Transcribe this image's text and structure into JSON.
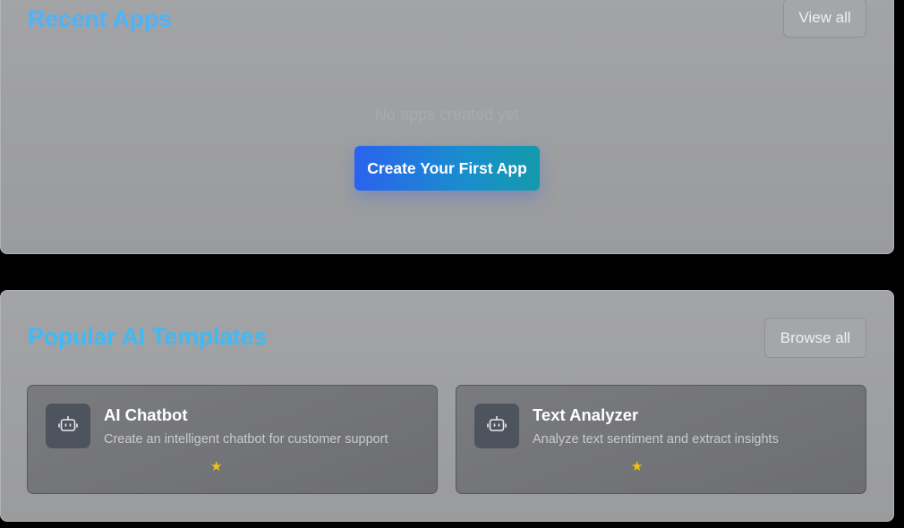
{
  "recent_apps": {
    "title": "Recent Apps",
    "view_all_label": "View all",
    "empty_text": "No apps created yet",
    "create_label": "Create Your First App"
  },
  "templates": {
    "title": "Popular AI Templates",
    "browse_all_label": "Browse all",
    "cards": [
      {
        "icon": "bot-icon",
        "title": "AI Chatbot",
        "description": "Create an intelligent chatbot for customer support",
        "rating_icon": "star-icon"
      },
      {
        "icon": "bot-icon",
        "title": "Text Analyzer",
        "description": "Analyze text sentiment and extract insights",
        "rating_icon": "star-icon"
      }
    ]
  },
  "colors": {
    "accent_gradient_start": "#2a63ee",
    "accent_gradient_end": "#139aaa",
    "title_blue": "#4fb4f7",
    "star_yellow": "#f2c20f"
  }
}
